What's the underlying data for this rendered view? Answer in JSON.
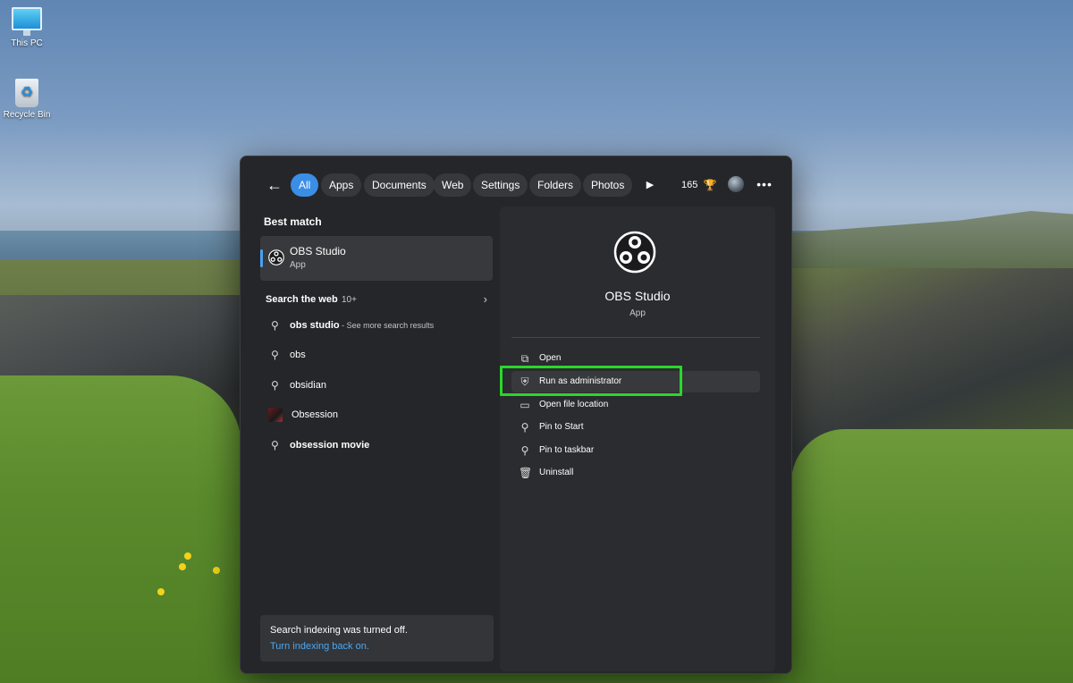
{
  "desktop": {
    "icons": [
      {
        "label": "This PC",
        "icon": "computer-icon"
      },
      {
        "label": "Recycle Bin",
        "icon": "recycle-bin-icon"
      }
    ]
  },
  "search": {
    "filters": [
      "All",
      "Apps",
      "Documents",
      "Web",
      "Settings",
      "Folders",
      "Photos"
    ],
    "active_filter": "All",
    "points": "165",
    "best_match_title": "Best match",
    "best_match": {
      "name": "OBS Studio",
      "kind": "App"
    },
    "web_section": {
      "title": "Search the web",
      "count": "10+"
    },
    "suggestions": [
      {
        "text": "obs studio",
        "suffix": "See more search results",
        "icon": "search-icon"
      },
      {
        "text": "obs",
        "icon": "search-icon"
      },
      {
        "text": "obsidian",
        "icon": "search-icon"
      },
      {
        "text": "Obsession",
        "icon": "movie-thumbnail"
      },
      {
        "text": "obsession movie",
        "icon": "search-icon"
      }
    ],
    "notice": {
      "text": "Search indexing was turned off.",
      "link": "Turn indexing back on."
    }
  },
  "detail": {
    "app_name": "OBS Studio",
    "app_kind": "App",
    "actions": [
      {
        "label": "Open",
        "icon": "open-external-icon"
      },
      {
        "label": "Run as administrator",
        "icon": "shield-icon"
      },
      {
        "label": "Open file location",
        "icon": "folder-icon"
      },
      {
        "label": "Pin to Start",
        "icon": "pin-icon"
      },
      {
        "label": "Pin to taskbar",
        "icon": "pin-icon"
      },
      {
        "label": "Uninstall",
        "icon": "trash-icon"
      }
    ],
    "highlighted_action": "Run as administrator"
  },
  "colors": {
    "accent": "#3a8ee6",
    "highlight_box": "#29d82a",
    "link": "#4aa8f5"
  }
}
